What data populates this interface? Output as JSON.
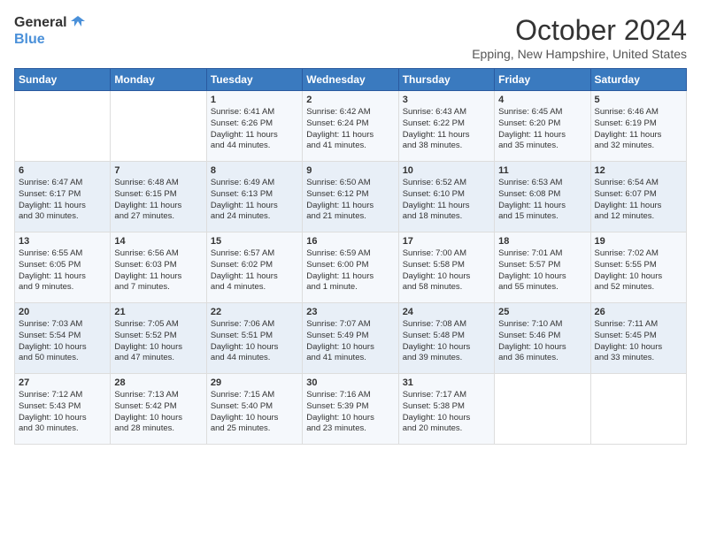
{
  "logo": {
    "text_general": "General",
    "text_blue": "Blue"
  },
  "header": {
    "month": "October 2024",
    "location": "Epping, New Hampshire, United States"
  },
  "days_of_week": [
    "Sunday",
    "Monday",
    "Tuesday",
    "Wednesday",
    "Thursday",
    "Friday",
    "Saturday"
  ],
  "weeks": [
    [
      {
        "day": "",
        "content": ""
      },
      {
        "day": "",
        "content": ""
      },
      {
        "day": "1",
        "content": "Sunrise: 6:41 AM\nSunset: 6:26 PM\nDaylight: 11 hours\nand 44 minutes."
      },
      {
        "day": "2",
        "content": "Sunrise: 6:42 AM\nSunset: 6:24 PM\nDaylight: 11 hours\nand 41 minutes."
      },
      {
        "day": "3",
        "content": "Sunrise: 6:43 AM\nSunset: 6:22 PM\nDaylight: 11 hours\nand 38 minutes."
      },
      {
        "day": "4",
        "content": "Sunrise: 6:45 AM\nSunset: 6:20 PM\nDaylight: 11 hours\nand 35 minutes."
      },
      {
        "day": "5",
        "content": "Sunrise: 6:46 AM\nSunset: 6:19 PM\nDaylight: 11 hours\nand 32 minutes."
      }
    ],
    [
      {
        "day": "6",
        "content": "Sunrise: 6:47 AM\nSunset: 6:17 PM\nDaylight: 11 hours\nand 30 minutes."
      },
      {
        "day": "7",
        "content": "Sunrise: 6:48 AM\nSunset: 6:15 PM\nDaylight: 11 hours\nand 27 minutes."
      },
      {
        "day": "8",
        "content": "Sunrise: 6:49 AM\nSunset: 6:13 PM\nDaylight: 11 hours\nand 24 minutes."
      },
      {
        "day": "9",
        "content": "Sunrise: 6:50 AM\nSunset: 6:12 PM\nDaylight: 11 hours\nand 21 minutes."
      },
      {
        "day": "10",
        "content": "Sunrise: 6:52 AM\nSunset: 6:10 PM\nDaylight: 11 hours\nand 18 minutes."
      },
      {
        "day": "11",
        "content": "Sunrise: 6:53 AM\nSunset: 6:08 PM\nDaylight: 11 hours\nand 15 minutes."
      },
      {
        "day": "12",
        "content": "Sunrise: 6:54 AM\nSunset: 6:07 PM\nDaylight: 11 hours\nand 12 minutes."
      }
    ],
    [
      {
        "day": "13",
        "content": "Sunrise: 6:55 AM\nSunset: 6:05 PM\nDaylight: 11 hours\nand 9 minutes."
      },
      {
        "day": "14",
        "content": "Sunrise: 6:56 AM\nSunset: 6:03 PM\nDaylight: 11 hours\nand 7 minutes."
      },
      {
        "day": "15",
        "content": "Sunrise: 6:57 AM\nSunset: 6:02 PM\nDaylight: 11 hours\nand 4 minutes."
      },
      {
        "day": "16",
        "content": "Sunrise: 6:59 AM\nSunset: 6:00 PM\nDaylight: 11 hours\nand 1 minute."
      },
      {
        "day": "17",
        "content": "Sunrise: 7:00 AM\nSunset: 5:58 PM\nDaylight: 10 hours\nand 58 minutes."
      },
      {
        "day": "18",
        "content": "Sunrise: 7:01 AM\nSunset: 5:57 PM\nDaylight: 10 hours\nand 55 minutes."
      },
      {
        "day": "19",
        "content": "Sunrise: 7:02 AM\nSunset: 5:55 PM\nDaylight: 10 hours\nand 52 minutes."
      }
    ],
    [
      {
        "day": "20",
        "content": "Sunrise: 7:03 AM\nSunset: 5:54 PM\nDaylight: 10 hours\nand 50 minutes."
      },
      {
        "day": "21",
        "content": "Sunrise: 7:05 AM\nSunset: 5:52 PM\nDaylight: 10 hours\nand 47 minutes."
      },
      {
        "day": "22",
        "content": "Sunrise: 7:06 AM\nSunset: 5:51 PM\nDaylight: 10 hours\nand 44 minutes."
      },
      {
        "day": "23",
        "content": "Sunrise: 7:07 AM\nSunset: 5:49 PM\nDaylight: 10 hours\nand 41 minutes."
      },
      {
        "day": "24",
        "content": "Sunrise: 7:08 AM\nSunset: 5:48 PM\nDaylight: 10 hours\nand 39 minutes."
      },
      {
        "day": "25",
        "content": "Sunrise: 7:10 AM\nSunset: 5:46 PM\nDaylight: 10 hours\nand 36 minutes."
      },
      {
        "day": "26",
        "content": "Sunrise: 7:11 AM\nSunset: 5:45 PM\nDaylight: 10 hours\nand 33 minutes."
      }
    ],
    [
      {
        "day": "27",
        "content": "Sunrise: 7:12 AM\nSunset: 5:43 PM\nDaylight: 10 hours\nand 30 minutes."
      },
      {
        "day": "28",
        "content": "Sunrise: 7:13 AM\nSunset: 5:42 PM\nDaylight: 10 hours\nand 28 minutes."
      },
      {
        "day": "29",
        "content": "Sunrise: 7:15 AM\nSunset: 5:40 PM\nDaylight: 10 hours\nand 25 minutes."
      },
      {
        "day": "30",
        "content": "Sunrise: 7:16 AM\nSunset: 5:39 PM\nDaylight: 10 hours\nand 23 minutes."
      },
      {
        "day": "31",
        "content": "Sunrise: 7:17 AM\nSunset: 5:38 PM\nDaylight: 10 hours\nand 20 minutes."
      },
      {
        "day": "",
        "content": ""
      },
      {
        "day": "",
        "content": ""
      }
    ]
  ]
}
